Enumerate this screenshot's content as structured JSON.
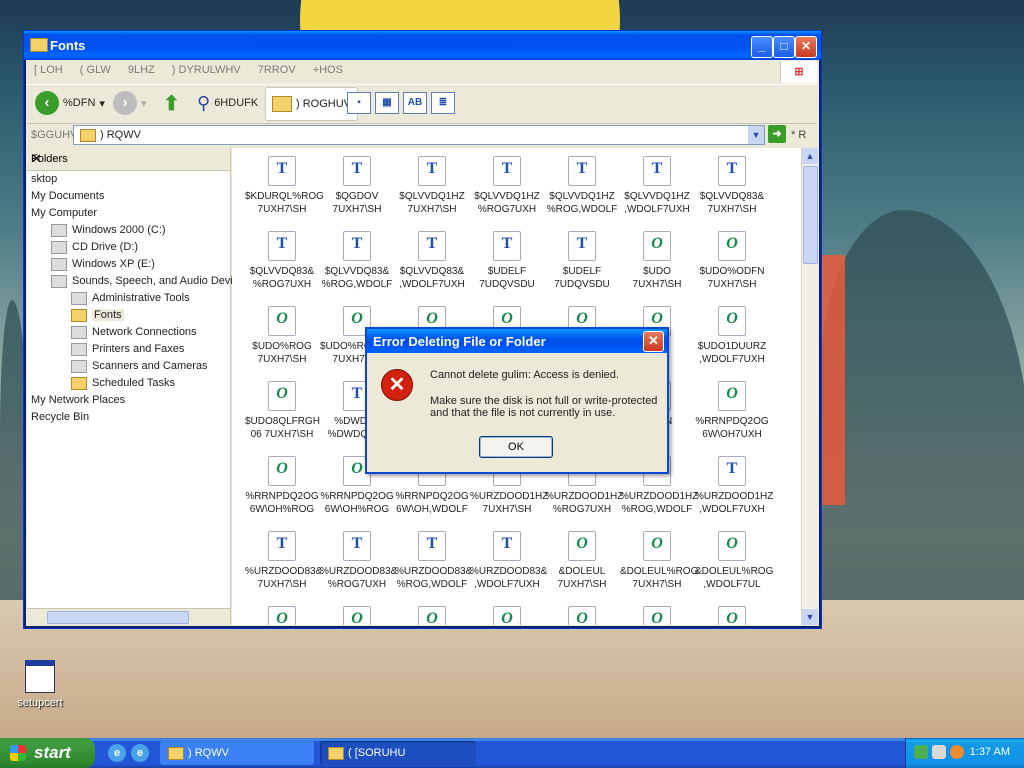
{
  "window": {
    "title": "Fonts"
  },
  "menu": [
    "[ LOH",
    "( GLW",
    "9LHZ",
    ") DYRULWHV",
    "7RROV",
    "+HOS"
  ],
  "toolbar": {
    "back": "%DFN",
    "search": "6HDUFK",
    "folders": ") ROGHUV"
  },
  "address": {
    "label": "$GGUHVV",
    "value": ") RQWV",
    "go": "* R"
  },
  "folders_pane": {
    "header": "Folders",
    "close": "✕",
    "items": [
      {
        "label": "sktop",
        "indent": 0,
        "icon": "desktop-icon"
      },
      {
        "label": "My Documents",
        "indent": 0,
        "icon": "folder-icon"
      },
      {
        "label": "My Computer",
        "indent": 0,
        "icon": "computer-icon"
      },
      {
        "label": "Windows 2000 (C:)",
        "indent": 1,
        "icon": "drive-icon"
      },
      {
        "label": "CD Drive (D:)",
        "indent": 1,
        "icon": "cd-icon"
      },
      {
        "label": "Windows XP (E:)",
        "indent": 1,
        "icon": "drive-icon"
      },
      {
        "label": "Sounds, Speech, and Audio Devices",
        "indent": 1,
        "icon": "audio-icon"
      },
      {
        "label": "Administrative Tools",
        "indent": 2,
        "icon": "admin-tools-icon"
      },
      {
        "label": "Fonts",
        "indent": 2,
        "icon": "folder-icon",
        "selected": true
      },
      {
        "label": "Network Connections",
        "indent": 2,
        "icon": "network-icon"
      },
      {
        "label": "Printers and Faxes",
        "indent": 2,
        "icon": "printer-icon"
      },
      {
        "label": "Scanners and Cameras",
        "indent": 2,
        "icon": "scanner-icon"
      },
      {
        "label": "Scheduled Tasks",
        "indent": 2,
        "icon": "folder-icon"
      },
      {
        "label": "My Network Places",
        "indent": 0,
        "icon": "network-places-icon"
      },
      {
        "label": "Recycle Bin",
        "indent": 0,
        "icon": "recycle-bin-icon"
      }
    ]
  },
  "files": [
    {
      "type": "tt",
      "l1": "$KDURQL%ROG",
      "l2": "7UXH7\\SH"
    },
    {
      "type": "tt",
      "l1": "$QGDOV",
      "l2": "7UXH7\\SH"
    },
    {
      "type": "tt",
      "l1": "$QLVVDQ1HZ",
      "l2": "7UXH7\\SH"
    },
    {
      "type": "tt",
      "l1": "$QLVVDQ1HZ",
      "l2": "%ROG7UXH"
    },
    {
      "type": "tt",
      "l1": "$QLVVDQ1HZ",
      "l2": "%ROG,WDOLF"
    },
    {
      "type": "tt",
      "l1": "$QLVVDQ1HZ",
      "l2": ",WDOLF7UXH"
    },
    {
      "type": "tt",
      "l1": "$QLVVDQ83&",
      "l2": "7UXH7\\SH"
    },
    {
      "type": "tt",
      "l1": "$QLVVDQ83&",
      "l2": "%ROG7UXH"
    },
    {
      "type": "tt",
      "l1": "$QLVVDQ83&",
      "l2": "%ROG,WDOLF"
    },
    {
      "type": "tt",
      "l1": "$QLVVDQ83&",
      "l2": ",WDOLF7UXH"
    },
    {
      "type": "tt",
      "l1": "$UDELF",
      "l2": "7UDQVSDU"
    },
    {
      "type": "tt",
      "l1": "$UDELF",
      "l2": "7UDQVSDU"
    },
    {
      "type": "o",
      "l1": "$UDO",
      "l2": "7UXH7\\SH"
    },
    {
      "type": "o",
      "l1": "$UDO%ODFN",
      "l2": "7UXH7\\SH"
    },
    {
      "type": "o",
      "l1": "$UDO%ROG",
      "l2": "7UXH7\\SH"
    },
    {
      "type": "o",
      "l1": "$UDO%ROG,WDOLF",
      "l2": "7UXH7\\SH"
    },
    {
      "type": "o",
      "l1": "",
      "l2": ""
    },
    {
      "type": "o",
      "l1": "",
      "l2": ""
    },
    {
      "type": "o",
      "l1": "",
      "l2": ""
    },
    {
      "type": "o",
      "l1": "",
      "l2": ""
    },
    {
      "type": "o",
      "l1": "$UDO1DUURZ",
      "l2": ",WDOLF7UXH"
    },
    {
      "type": "o",
      "l1": "$UDO8QLFRGH",
      "l2": "06 7UXH7\\SH"
    },
    {
      "type": "tt",
      "l1": "%DWDQJ",
      "l2": "%DWDQJ&K"
    },
    {
      "type": "o",
      "l1": "",
      "l2": ""
    },
    {
      "type": "o",
      "l1": "",
      "l2": ""
    },
    {
      "type": "o",
      "l1": "",
      "l2": ""
    },
    {
      "type": "o",
      "l1": "%RRN",
      "l2": ""
    },
    {
      "type": "o",
      "l1": "%RRNPDQ2OG",
      "l2": "6W\\OH7UXH"
    },
    {
      "type": "o",
      "l1": "%RRNPDQ2OG",
      "l2": "6W\\OH%ROG"
    },
    {
      "type": "o",
      "l1": "%RRNPDQ2OG",
      "l2": "6W\\OH%ROG"
    },
    {
      "type": "o",
      "l1": "%RRNPDQ2OG",
      "l2": "6W\\OH,WDOLF"
    },
    {
      "type": "tt",
      "l1": "%URZDOOD1HZ",
      "l2": "7UXH7\\SH"
    },
    {
      "type": "tt",
      "l1": "%URZDOOD1HZ",
      "l2": "%ROG7UXH"
    },
    {
      "type": "tt",
      "l1": "%URZDOOD1HZ",
      "l2": "%ROG,WDOLF"
    },
    {
      "type": "tt",
      "l1": "%URZDOOD1HZ",
      "l2": ",WDOLF7UXH"
    },
    {
      "type": "tt",
      "l1": "%URZDOOD83&",
      "l2": "7UXH7\\SH"
    },
    {
      "type": "tt",
      "l1": "%URZDOOD83&",
      "l2": "%ROG7UXH"
    },
    {
      "type": "tt",
      "l1": "%URZDOOD83&",
      "l2": "%ROG,WDOLF"
    },
    {
      "type": "tt",
      "l1": "%URZDOOD83&",
      "l2": ",WDOLF7UXH"
    },
    {
      "type": "o",
      "l1": "&DOLEUL",
      "l2": "7UXH7\\SH"
    },
    {
      "type": "o",
      "l1": "&DOLEUL%ROG",
      "l2": "7UXH7\\SH"
    },
    {
      "type": "o",
      "l1": "&DOLEUL%ROG",
      "l2": ",WDOLF7UL"
    },
    {
      "type": "o",
      "l1": "",
      "l2": ""
    },
    {
      "type": "o",
      "l1": "",
      "l2": ""
    },
    {
      "type": "o",
      "l1": "",
      "l2": ""
    },
    {
      "type": "o",
      "l1": "",
      "l2": ""
    },
    {
      "type": "o",
      "l1": "",
      "l2": ""
    },
    {
      "type": "o",
      "l1": "",
      "l2": ""
    },
    {
      "type": "o",
      "l1": "",
      "l2": ""
    }
  ],
  "dialog": {
    "title": "Error Deleting File or Folder",
    "close": "✕",
    "message": "Cannot delete gulim: Access is denied.",
    "detail": "Make sure the disk is not full or write-protected and that the file is not currently in use.",
    "ok": "OK"
  },
  "desktop": {
    "setup_label": "setupcert"
  },
  "taskbar": {
    "start": "start",
    "tasks": [
      ") RQWV",
      "( [SORUHU"
    ],
    "time": "1:37 AM"
  },
  "colors": {
    "xp_blue": "#0053ee",
    "start_green": "#3c9a3c",
    "error_red": "#d3210d"
  }
}
